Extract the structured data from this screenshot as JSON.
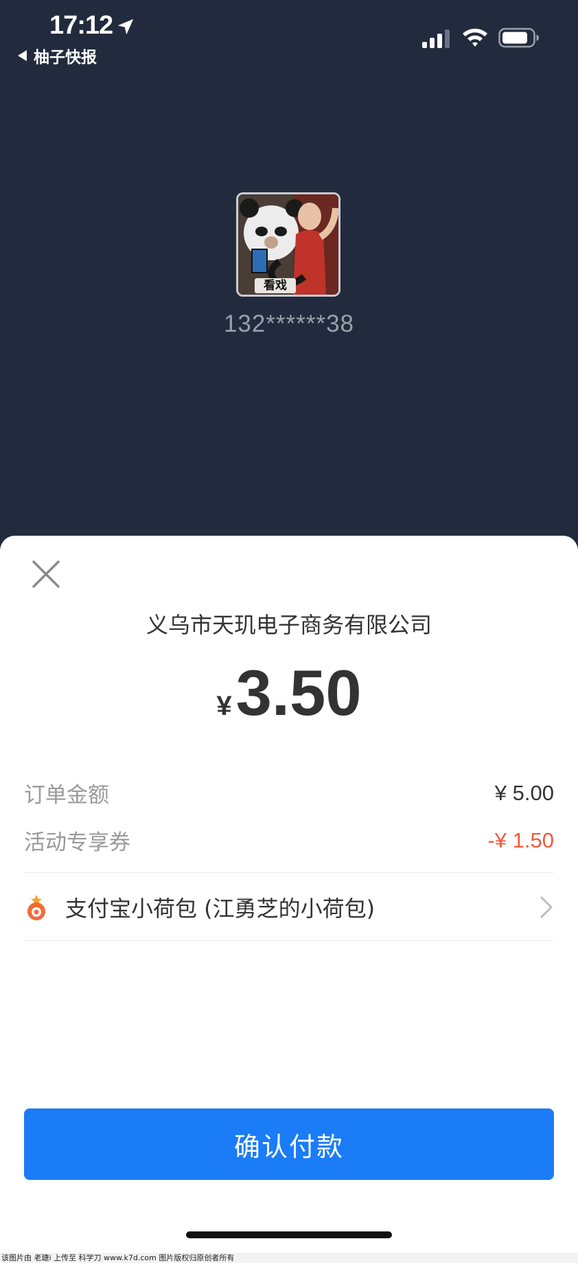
{
  "status_bar": {
    "time": "17:12",
    "back_app": "柚子快报",
    "location_icon": "location-arrow-icon",
    "signal_icon": "cellular-signal-icon",
    "wifi_icon": "wifi-icon",
    "battery_icon": "battery-icon"
  },
  "profile": {
    "avatar_caption": "看戏",
    "phone": "132******38"
  },
  "payment": {
    "close_icon": "close-icon",
    "merchant": "义乌市天玑电子商务有限公司",
    "currency_symbol": "¥",
    "amount": "3.50",
    "details": [
      {
        "label": "订单金额",
        "value": "¥ 5.00"
      },
      {
        "label": "活动专享券",
        "value": "-¥ 1.50"
      }
    ],
    "method": {
      "icon": "wallet-icon",
      "label": "支付宝小荷包 (江勇芝的小荷包)",
      "chevron": "chevron-right-icon"
    },
    "confirm_label": "确认付款"
  },
  "colors": {
    "header_bg": "#222b3e",
    "primary": "#1a7cf7",
    "discount": "#f25a3a"
  },
  "watermark": "该图片由 老瑭i 上传至 科学刀 www.k7d.com 图片版权归原创者所有"
}
